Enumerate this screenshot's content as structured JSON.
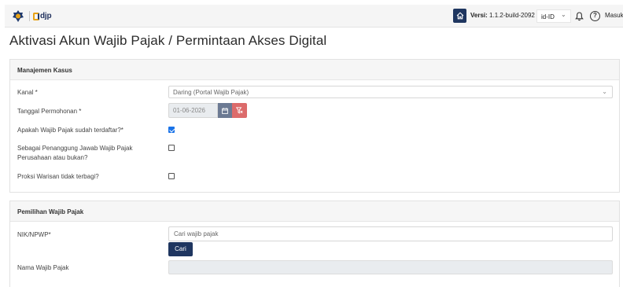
{
  "header": {
    "brand_text": "djp",
    "version_label": "Versi:",
    "version_value": "1.1.2-build-2092",
    "language": "id-ID",
    "help_glyph": "?",
    "login_label": "Masuk",
    "icons": [
      "kemenkeu-emblem-icon",
      "home-icon",
      "chevron-down-icon",
      "bell-icon",
      "help-icon"
    ]
  },
  "page": {
    "title": "Aktivasi Akun Wajib Pajak / Permintaan Akses Digital"
  },
  "case_panel": {
    "heading": "Manajemen Kasus",
    "channel": {
      "label": "Kanal *",
      "value": "Daring (Portal Wajib Pajak)"
    },
    "request_date": {
      "label": "Tanggal Permohonan *",
      "value": "01-06-2026"
    },
    "registered": {
      "label": "Apakah Wajib Pajak sudah terdaftar?*",
      "checked": true
    },
    "company_pic": {
      "label": "Sebagai Penanggung Jawab Wajib Pajak Perusahaan atau bukan?",
      "checked": false
    },
    "undivided_estate": {
      "label": "Proksi Warisan tidak terbagi?",
      "checked": false
    }
  },
  "taxpayer_panel": {
    "heading": "Pemilihan Wajib Pajak",
    "nik_label": "NIK/NPWP*",
    "search_placeholder": "Cari wajib pajak",
    "search_button": "Cari",
    "name_label": "Nama Wajib Pajak",
    "name_value": ""
  },
  "colors": {
    "primary": "#1f3660",
    "danger": "#dc6b6b",
    "calendar_button": "#6c7a93",
    "checkbox_checked": "#1a73e8"
  }
}
